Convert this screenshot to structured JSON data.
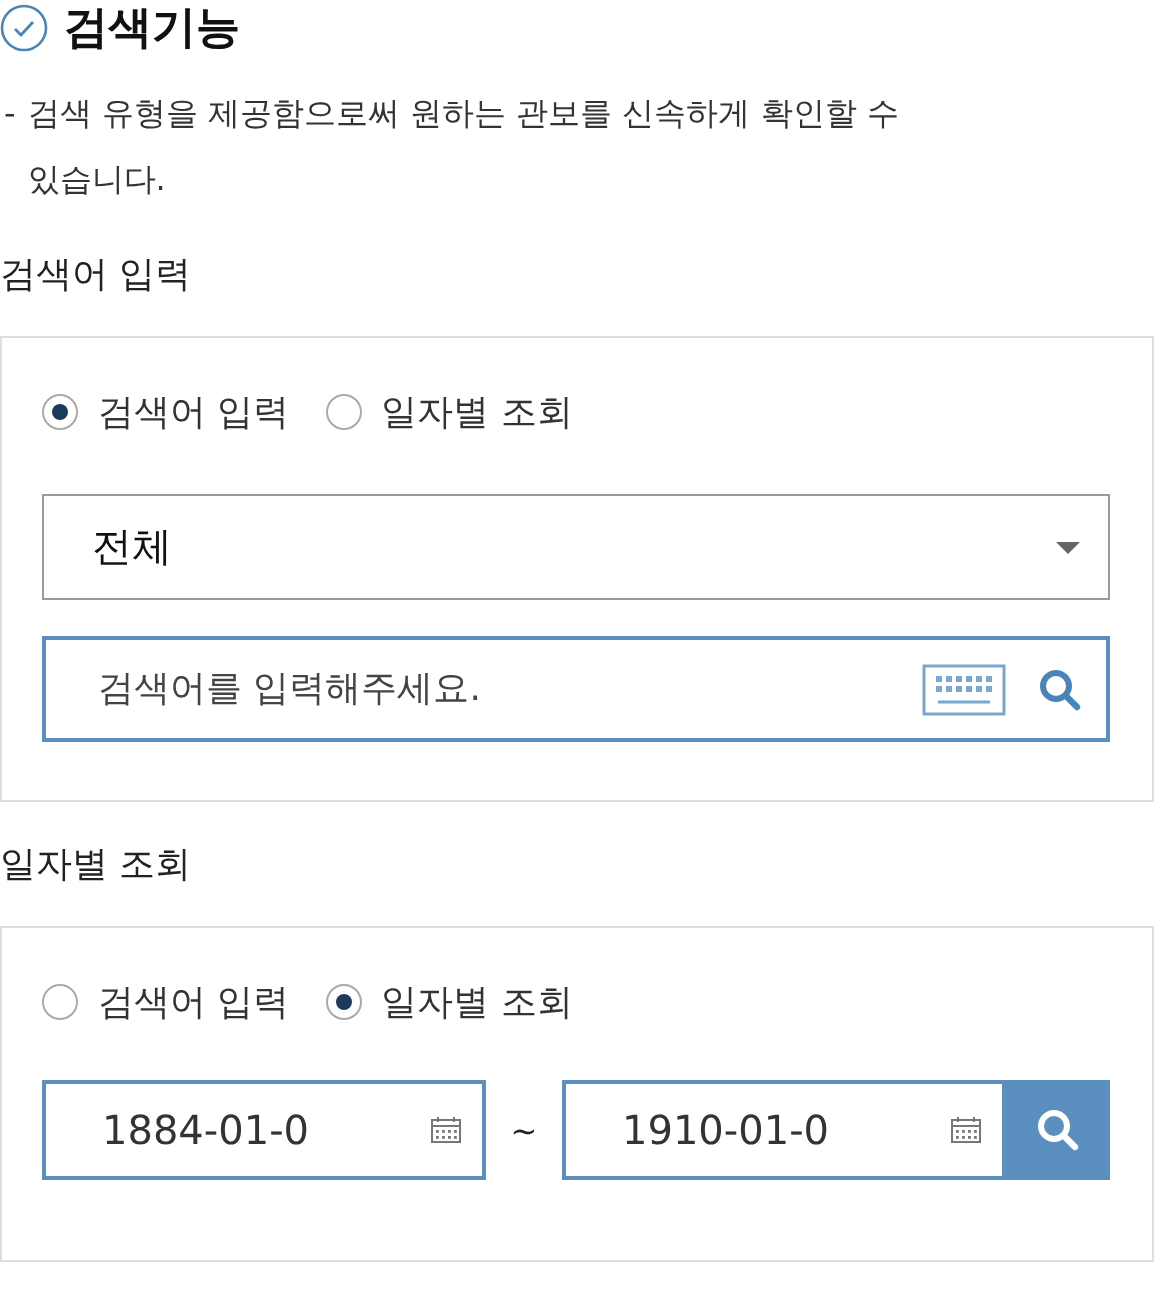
{
  "header": {
    "title": "검색기능",
    "bullet": "-",
    "description": "검색 유형을 제공함으로써 원하는 관보를 신속하게 확인할 수 있습니다."
  },
  "sections": [
    {
      "kind": "keyword",
      "title": "검색어 입력",
      "radios": [
        {
          "label": "검색어 입력",
          "selected": true
        },
        {
          "label": "일자별 조회",
          "selected": false
        }
      ],
      "select": {
        "value": "전체"
      },
      "search": {
        "placeholder": "검색어를 입력해주세요."
      }
    },
    {
      "kind": "date",
      "title": "일자별 조회",
      "radios": [
        {
          "label": "검색어 입력",
          "selected": false
        },
        {
          "label": "일자별 조회",
          "selected": true
        }
      ],
      "from": "1884-01-0",
      "separator": "~",
      "to": "1910-01-0"
    }
  ]
}
